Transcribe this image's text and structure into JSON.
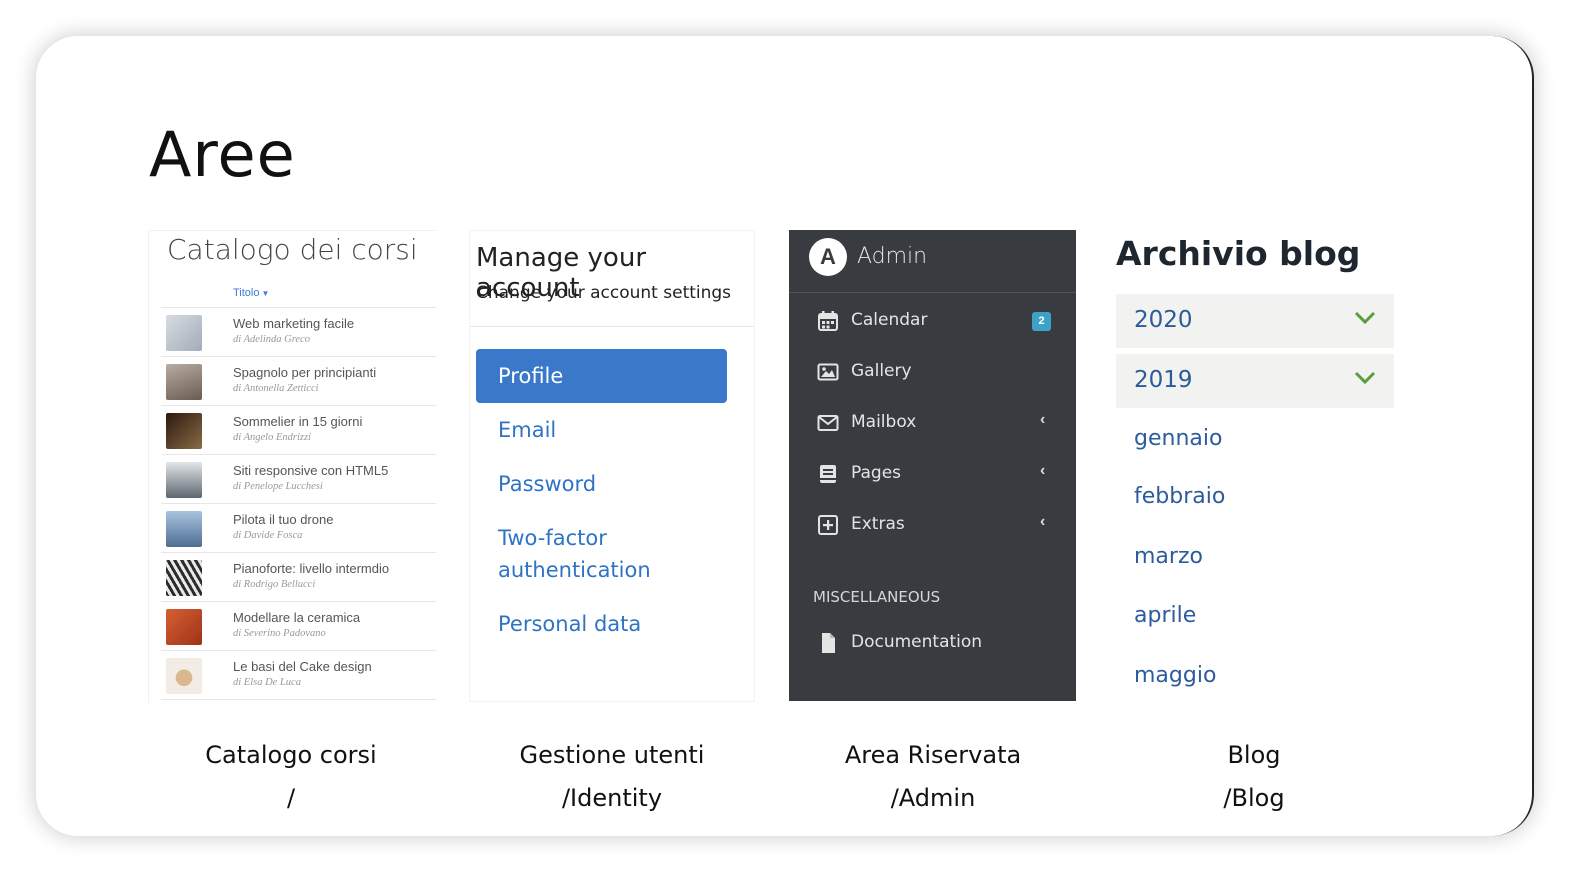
{
  "slide": {
    "title": "Aree"
  },
  "catalog": {
    "heading": "Catalogo dei corsi",
    "sort_label": "Titolo",
    "courses": [
      {
        "title": "Web marketing facile",
        "author": "di Adelinda Greco",
        "thumb_color": "#b9c3cf"
      },
      {
        "title": "Spagnolo per principianti",
        "author": "di Antonella Zetticci",
        "thumb_color": "#8e7f74"
      },
      {
        "title": "Sommelier in 15 giorni",
        "author": "di Angelo Endrizzi",
        "thumb_color": "#4b3324"
      },
      {
        "title": "Siti responsive con HTML5",
        "author": "di Penelope Lucchesi",
        "thumb_color": "#a7adb3"
      },
      {
        "title": "Pilota il tuo drone",
        "author": "di Davide Fosca",
        "thumb_color": "#6e8fb4"
      },
      {
        "title": "Pianoforte: livello intermdio",
        "author": "di Rodrigo Bellucci",
        "thumb_color": "#6b6560"
      },
      {
        "title": "Modellare la ceramica",
        "author": "di Severino Padovano",
        "thumb_color": "#c2542c"
      },
      {
        "title": "Le basi del Cake design",
        "author": "di Elsa De Luca",
        "thumb_color": "#e6ddd1"
      }
    ]
  },
  "account": {
    "heading": "Manage your account",
    "subheading": "Change your account settings",
    "nav": [
      {
        "label": "Profile",
        "active": true
      },
      {
        "label": "Email"
      },
      {
        "label": "Password"
      },
      {
        "label": "Two-factor authentication"
      },
      {
        "label": "Personal data"
      }
    ]
  },
  "admin": {
    "brand": "Admin",
    "logo_letter": "A",
    "items": [
      {
        "label": "Calendar",
        "icon": "calendar-icon",
        "badge": "2"
      },
      {
        "label": "Gallery",
        "icon": "image-icon"
      },
      {
        "label": "Mailbox",
        "icon": "envelope-icon",
        "chevron": "‹"
      },
      {
        "label": "Pages",
        "icon": "book-icon",
        "chevron": "‹"
      },
      {
        "label": "Extras",
        "icon": "plus-square-icon",
        "chevron": "‹"
      }
    ],
    "section_label": "MISCELLANEOUS",
    "misc_items": [
      {
        "label": "Documentation",
        "icon": "file-icon"
      }
    ]
  },
  "blog": {
    "heading": "Archivio blog",
    "years": [
      "2020",
      "2019"
    ],
    "months": [
      "gennaio",
      "febbraio",
      "marzo",
      "aprile",
      "maggio"
    ],
    "chevron_color": "#5a9e3c"
  },
  "captions": [
    {
      "line1": "Catalogo corsi",
      "line2": "/"
    },
    {
      "line1": "Gestione utenti",
      "line2": "/Identity"
    },
    {
      "line1": "Area Riservata",
      "line2": "/Admin"
    },
    {
      "line1": "Blog",
      "line2": "/Blog"
    }
  ],
  "colors": {
    "admin_bg": "#383c40",
    "link": "#2f73c5",
    "active": "#3a78c9",
    "badge": "#3ea2c8"
  }
}
